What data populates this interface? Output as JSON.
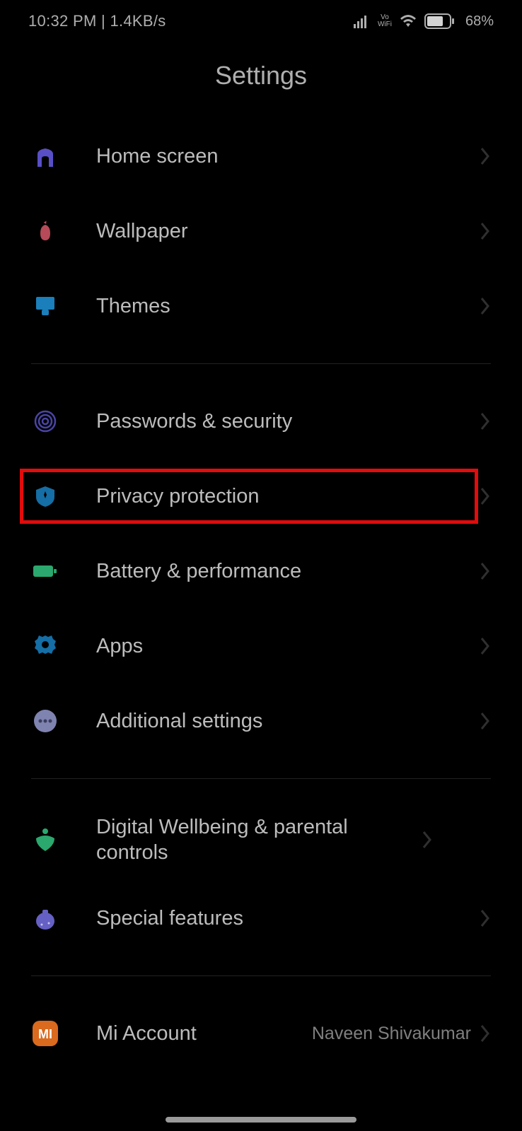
{
  "status": {
    "time": "10:32 PM",
    "net_speed": "1.4KB/s",
    "battery": "68%",
    "vowifi_top": "Vo",
    "vowifi_bottom": "WiFi"
  },
  "title": "Settings",
  "items": [
    {
      "key": "home",
      "label": "Home screen"
    },
    {
      "key": "wallpaper",
      "label": "Wallpaper"
    },
    {
      "key": "themes",
      "label": "Themes"
    },
    {
      "key": "passwords",
      "label": "Passwords & security"
    },
    {
      "key": "privacy",
      "label": "Privacy protection"
    },
    {
      "key": "battery",
      "label": "Battery & performance"
    },
    {
      "key": "apps",
      "label": "Apps"
    },
    {
      "key": "additional",
      "label": "Additional settings"
    },
    {
      "key": "wellbeing",
      "label": "Digital Wellbeing & parental controls"
    },
    {
      "key": "special",
      "label": "Special features"
    },
    {
      "key": "account",
      "label": "Mi Account",
      "value": "Naveen Shivakumar"
    }
  ],
  "highlighted_item": "privacy"
}
